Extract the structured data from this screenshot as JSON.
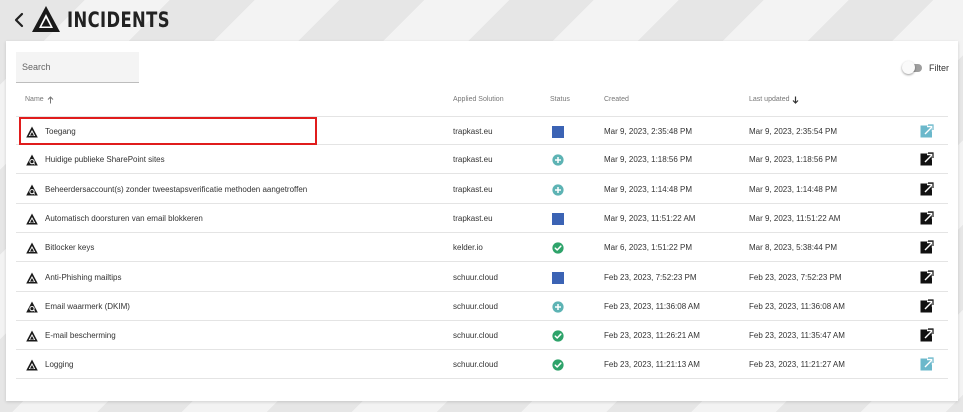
{
  "header": {
    "title": "INCIDENTS",
    "back_icon": "chevron-left-icon",
    "logo_icon": "triangle-logo-icon"
  },
  "toolbar": {
    "search_placeholder": "Search",
    "filter_label": "Filter",
    "filter_on": false
  },
  "columns": {
    "name": "Name",
    "applied_solution": "Applied Solution",
    "status": "Status",
    "created": "Created",
    "last_updated": "Last updated"
  },
  "colors": {
    "status_square": "#3b63b4",
    "status_plus": "#5db3b4",
    "status_check": "#2ea36a",
    "open_active": "#111111",
    "open_disabled": "#6bb8cb",
    "highlight": "#e01c1c"
  },
  "rows": [
    {
      "name": "Toegang",
      "solution": "trapkast.eu",
      "status": "square",
      "created": "Mar 9, 2023, 2:35:48 PM",
      "updated": "Mar 9, 2023, 2:35:54 PM",
      "type_icon": "triangle-alert-icon",
      "open": "disabled"
    },
    {
      "name": "Huidige publieke SharePoint sites",
      "solution": "trapkast.eu",
      "status": "plus",
      "created": "Mar 9, 2023, 1:18:56 PM",
      "updated": "Mar 9, 2023, 1:18:56 PM",
      "type_icon": "triangle-search-icon",
      "open": "active"
    },
    {
      "name": "Beheerdersaccount(s) zonder tweestapsverificatie methoden aangetroffen",
      "solution": "trapkast.eu",
      "status": "plus",
      "created": "Mar 9, 2023, 1:14:48 PM",
      "updated": "Mar 9, 2023, 1:14:48 PM",
      "type_icon": "triangle-search-icon",
      "open": "active"
    },
    {
      "name": "Automatisch doorsturen van email blokkeren",
      "solution": "trapkast.eu",
      "status": "square",
      "created": "Mar 9, 2023, 11:51:22 AM",
      "updated": "Mar 9, 2023, 11:51:22 AM",
      "type_icon": "triangle-alert-icon",
      "open": "active"
    },
    {
      "name": "Bitlocker keys",
      "solution": "kelder.io",
      "status": "check",
      "created": "Mar 6, 2023, 1:51:22 PM",
      "updated": "Mar 8, 2023, 5:38:44 PM",
      "type_icon": "triangle-alert-icon",
      "open": "active"
    },
    {
      "name": "Anti-Phishing mailtips",
      "solution": "schuur.cloud",
      "status": "square",
      "created": "Feb 23, 2023, 7:52:23 PM",
      "updated": "Feb 23, 2023, 7:52:23 PM",
      "type_icon": "triangle-alert-icon",
      "open": "active"
    },
    {
      "name": "Email waarmerk (DKIM)",
      "solution": "schuur.cloud",
      "status": "plus",
      "created": "Feb 23, 2023, 11:36:08 AM",
      "updated": "Feb 23, 2023, 11:36:08 AM",
      "type_icon": "triangle-search-icon",
      "open": "active"
    },
    {
      "name": "E-mail bescherming",
      "solution": "schuur.cloud",
      "status": "check",
      "created": "Feb 23, 2023, 11:26:21 AM",
      "updated": "Feb 23, 2023, 11:35:47 AM",
      "type_icon": "triangle-alert-icon",
      "open": "active"
    },
    {
      "name": "Logging",
      "solution": "schuur.cloud",
      "status": "check",
      "created": "Feb 23, 2023, 11:21:13 AM",
      "updated": "Feb 23, 2023, 11:21:27 AM",
      "type_icon": "triangle-alert-icon",
      "open": "disabled"
    }
  ]
}
